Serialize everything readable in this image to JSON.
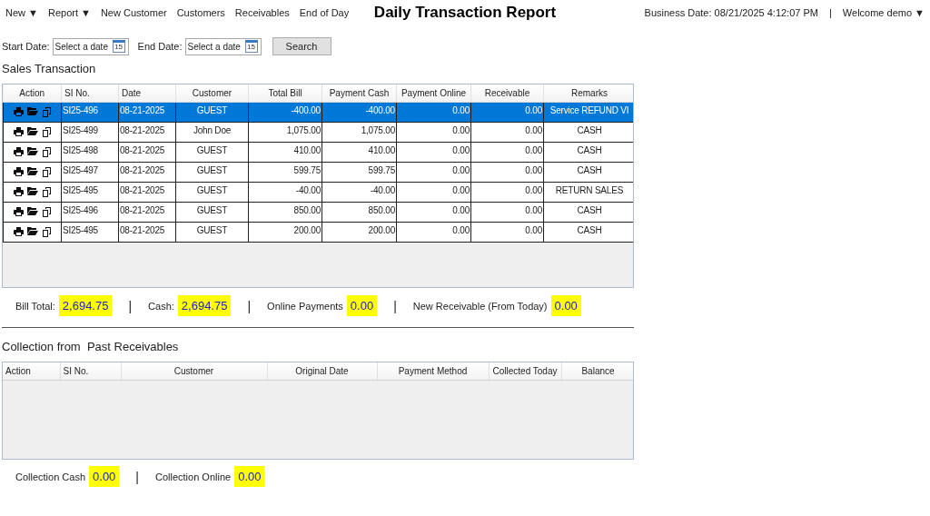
{
  "menu": [
    {
      "label": "New",
      "caret": "▼"
    },
    {
      "label": "Report",
      "caret": "▼"
    },
    {
      "label": "New Customer"
    },
    {
      "label": "Customers"
    },
    {
      "label": "Receivables"
    },
    {
      "label": "End of Day"
    }
  ],
  "title": "Daily Transaction Report",
  "business_date": "Business Date: 08/21/2025 4:12:07 PM",
  "header_separator": "|",
  "user": {
    "label": "Welcome demo",
    "caret": "▼"
  },
  "filters": {
    "start": {
      "label": "Start Date:",
      "placeholder": "Select a date",
      "calendar_day": "15"
    },
    "end": {
      "label": "End Date:",
      "placeholder": "Select a date",
      "calendar_day": "15"
    },
    "search_button": "Search"
  },
  "sales": {
    "title": "Sales Transaction",
    "columns": [
      "Action",
      "SI No.",
      "Date",
      "Customer",
      "Total Bill",
      "Payment Cash",
      "Payment Online",
      "Receivable",
      "Remarks"
    ],
    "rows": [
      {
        "selected": true,
        "cells": [
          "",
          "SI25-496",
          "08-21-2025",
          "GUEST",
          "-400.00",
          "-400.00",
          "0.00",
          "0.00",
          "Service REFUND VI"
        ]
      },
      {
        "selected": false,
        "cells": [
          "",
          "SI25-499",
          "08-21-2025",
          "John Doe",
          "1,075.00",
          "1,075.00",
          "0.00",
          "0.00",
          "CASH"
        ]
      },
      {
        "selected": false,
        "cells": [
          "",
          "SI25-498",
          "08-21-2025",
          "GUEST",
          "410.00",
          "410.00",
          "0.00",
          "0.00",
          "CASH"
        ]
      },
      {
        "selected": false,
        "cells": [
          "",
          "SI25-497",
          "08-21-2025",
          "GUEST",
          "599.75",
          "599.75",
          "0.00",
          "0.00",
          "CASH"
        ]
      },
      {
        "selected": false,
        "cells": [
          "",
          "SI25-495",
          "08-21-2025",
          "GUEST",
          "-40.00",
          "-40.00",
          "0.00",
          "0.00",
          "RETURN SALES"
        ]
      },
      {
        "selected": false,
        "cells": [
          "",
          "SI25-496",
          "08-21-2025",
          "GUEST",
          "850.00",
          "850.00",
          "0.00",
          "0.00",
          "CASH"
        ]
      },
      {
        "selected": false,
        "cells": [
          "",
          "SI25-495",
          "08-21-2025",
          "GUEST",
          "200.00",
          "200.00",
          "0.00",
          "0.00",
          "CASH"
        ]
      }
    ]
  },
  "sales_totals": [
    {
      "kind": "field",
      "label": "Bill Total:",
      "value": "2,694.75"
    },
    {
      "kind": "separator",
      "text": "|"
    },
    {
      "kind": "field",
      "label": "Cash:",
      "value": "2,694.75"
    },
    {
      "kind": "separator",
      "text": "|"
    },
    {
      "kind": "field",
      "label": "Online Payments",
      "value": "0.00"
    },
    {
      "kind": "separator",
      "text": "|"
    },
    {
      "kind": "field",
      "label": "New Receivable (From Today)",
      "value": "0.00"
    }
  ],
  "collections": {
    "title": "Collection from  Past Receivables",
    "columns": [
      "Action",
      "SI No.",
      "Customer",
      "Original Date",
      "Payment Method",
      "Collected Today",
      "Balance"
    ]
  },
  "collection_totals": [
    {
      "kind": "field",
      "label": "Collection Cash",
      "value": "0.00"
    },
    {
      "kind": "separator",
      "text": "|"
    },
    {
      "kind": "field",
      "label": "Collection Online",
      "value": "0.00"
    }
  ]
}
